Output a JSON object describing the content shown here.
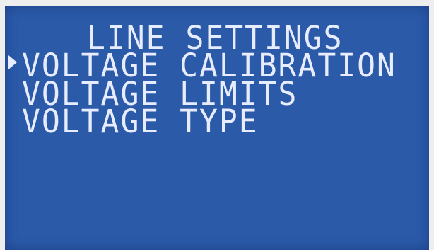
{
  "screen": {
    "title": "LINE SETTINGS",
    "menu": [
      {
        "label": "VOLTAGE CALIBRATION",
        "selected": true
      },
      {
        "label": "VOLTAGE LIMITS",
        "selected": false
      },
      {
        "label": "VOLTAGE TYPE",
        "selected": false
      }
    ],
    "cursor_icon": "triangle-right-icon",
    "colors": {
      "background": "#2b5aa9",
      "text": "#e8ecff",
      "frame": "#eeeeee"
    }
  }
}
